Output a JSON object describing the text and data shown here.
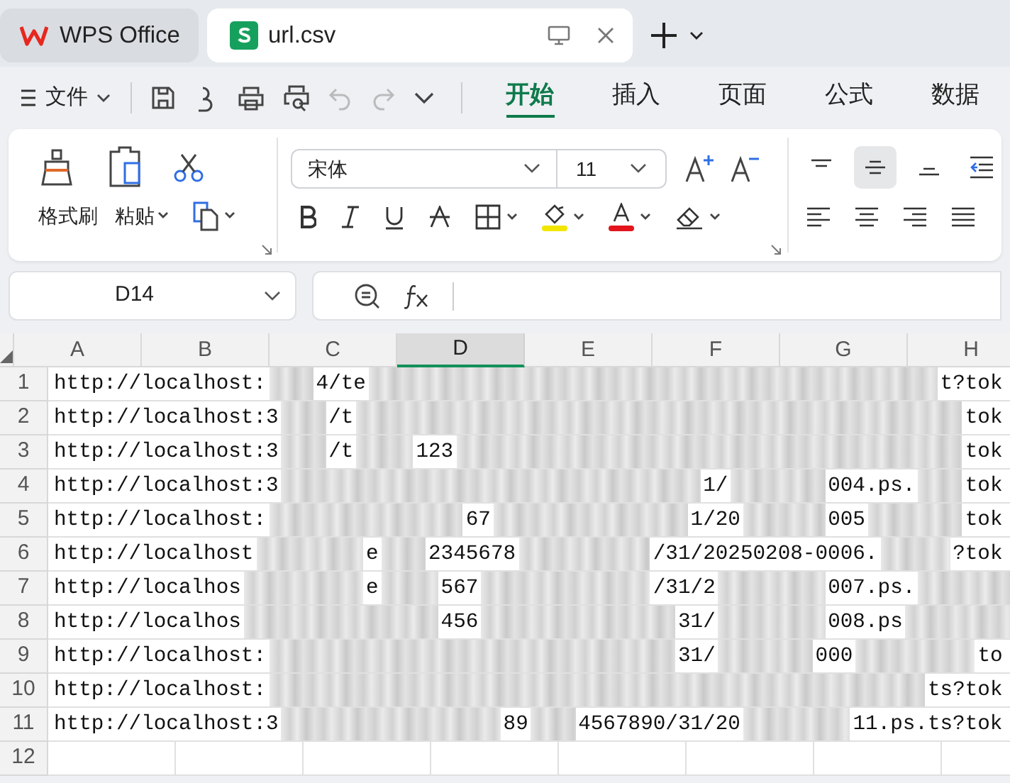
{
  "window_tabs": [
    {
      "kind": "home",
      "label": "WPS Office",
      "selected": false
    },
    {
      "kind": "document",
      "label": "url.csv",
      "selected": true
    }
  ],
  "menu": {
    "file": "文件",
    "tabs": [
      {
        "label": "开始",
        "selected": true
      },
      {
        "label": "插入",
        "selected": false
      },
      {
        "label": "页面",
        "selected": false
      },
      {
        "label": "公式",
        "selected": false
      },
      {
        "label": "数据",
        "selected": false
      }
    ]
  },
  "ribbon": {
    "format_painter": "格式刷",
    "paste": "粘贴",
    "font": "宋体",
    "font_size": "11"
  },
  "name_box": "D14",
  "columns": [
    {
      "label": "A",
      "selected": false
    },
    {
      "label": "B",
      "selected": false
    },
    {
      "label": "C",
      "selected": false
    },
    {
      "label": "D",
      "selected": true
    },
    {
      "label": "E",
      "selected": false
    },
    {
      "label": "F",
      "selected": false
    },
    {
      "label": "G",
      "selected": false
    },
    {
      "label": "H",
      "selected": false
    }
  ],
  "rows": [
    {
      "label": "1",
      "segments": [
        "http://localhost:",
        "4/te",
        "t?tok"
      ]
    },
    {
      "label": "2",
      "segments": [
        "http://localhost:3",
        "/t",
        "tok"
      ]
    },
    {
      "label": "3",
      "segments": [
        "http://localhost:3",
        "/t",
        "123",
        "tok"
      ]
    },
    {
      "label": "4",
      "segments": [
        "http://localhost:3",
        "1/",
        "004.ps.",
        "tok"
      ]
    },
    {
      "label": "5",
      "segments": [
        "http://localhost:",
        "67",
        "1/20",
        "005",
        "tok"
      ]
    },
    {
      "label": "6",
      "segments": [
        "http://localhost",
        "e",
        "2345678",
        "/31/20250208-0006.",
        "?tok"
      ]
    },
    {
      "label": "7",
      "segments": [
        "http://localhos",
        "e",
        "567",
        "/31/2",
        "007.ps."
      ]
    },
    {
      "label": "8",
      "segments": [
        "http://localhos",
        "456",
        "31/",
        "008.ps"
      ]
    },
    {
      "label": "9",
      "segments": [
        "http://localhost:",
        "31/",
        "000",
        "to"
      ]
    },
    {
      "label": "10",
      "segments": [
        "http://localhost:",
        "ts?tok"
      ]
    },
    {
      "label": "11",
      "segments": [
        "http://localhost:3",
        "89",
        "4567890/31/20",
        "11.ps.ts?tok"
      ]
    },
    {
      "label": "12",
      "segments": []
    }
  ]
}
